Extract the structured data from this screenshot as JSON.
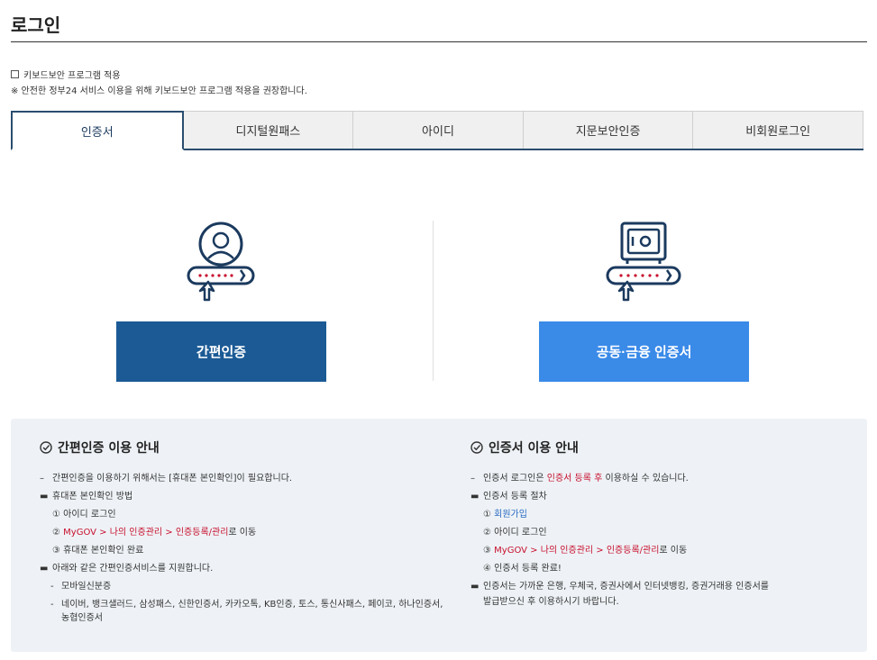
{
  "header": {
    "title": "로그인"
  },
  "keyboard": {
    "option_label": "키보드보안 프로그램 적용",
    "notice": "※ 안전한 정부24 서비스 이용을 위해 키보드보안 프로그램 적용을 권장합니다."
  },
  "tabs": [
    {
      "label": "인증서",
      "active": true
    },
    {
      "label": "디지털원패스",
      "active": false
    },
    {
      "label": "아이디",
      "active": false
    },
    {
      "label": "지문보안인증",
      "active": false
    },
    {
      "label": "비회원로그인",
      "active": false
    }
  ],
  "methods": {
    "simple_label": "간편인증",
    "cert_label": "공동·금융 인증서"
  },
  "guide_simple": {
    "title": "간편인증 이용 안내",
    "line1": "간편인증을 이용하기 위해서는 [휴대폰 본인확인]이 필요합니다.",
    "line2": "휴대폰 본인확인 방법",
    "step1": "① 아이디 로그인",
    "step2_num": "②",
    "step2_red": "MyGOV > 나의 인증관리 > 인증등록/관리",
    "step2_tail": "로 이동",
    "step3": "③ 휴대폰 본인확인 완료",
    "line3": "아래와 같은 간편인증서비스를 지원합니다.",
    "sub1": "모바일신분증",
    "sub2a": "네이버, 뱅크샐러드, 삼성패스, 신한인증서, 카카오톡, KB인증, 토스, 통신사패스, 페이코, 하나인증서,",
    "sub2b": "농협인증서"
  },
  "guide_cert": {
    "title": "인증서 이용 안내",
    "line1_head": "인증서 로그인은 ",
    "line1_red": "인증서 등록 후",
    "line1_tail": " 이용하실 수 있습니다.",
    "line2": "인증서 등록 절차",
    "step1_num": "①",
    "step1_link": "회원가입",
    "step2": "② 아이디 로그인",
    "step3_num": "③",
    "step3_red": "MyGOV > 나의 인증관리 > 인증등록/관리",
    "step3_tail": "로 이동",
    "step4": "④ 인증서 등록 완료!",
    "line3a": "인증서는 가까운 은행, 우체국, 증권사에서 인터넷뱅킹, 증권거래용 인증서를",
    "line3b": "발급받으신 후 이용하시기 바랍니다."
  },
  "colors": {
    "navy": "#1b5a95",
    "blue": "#3a8ae8",
    "red": "#c8102e",
    "tab_border": "#2b4d6e"
  }
}
